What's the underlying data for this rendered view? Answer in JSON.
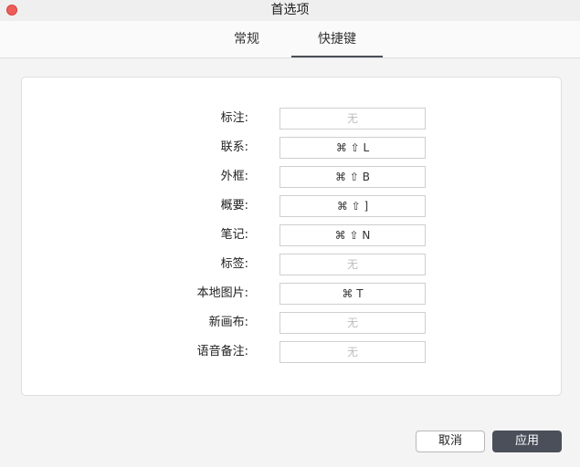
{
  "window": {
    "title": "首选项"
  },
  "tabs": [
    {
      "label": "常规",
      "active": false
    },
    {
      "label": "快捷键",
      "active": true
    }
  ],
  "shortcuts": [
    {
      "label": "标注:",
      "value": "无",
      "empty": true
    },
    {
      "label": "联系:",
      "value": "⌘ ⇧ L",
      "empty": false
    },
    {
      "label": "外框:",
      "value": "⌘ ⇧ B",
      "empty": false
    },
    {
      "label": "概要:",
      "value": "⌘ ⇧ ]",
      "empty": false
    },
    {
      "label": "笔记:",
      "value": "⌘ ⇧ N",
      "empty": false
    },
    {
      "label": "标签:",
      "value": "无",
      "empty": true
    },
    {
      "label": "本地图片:",
      "value": "⌘ T",
      "empty": false
    },
    {
      "label": "新画布:",
      "value": "无",
      "empty": true
    },
    {
      "label": "语音备注:",
      "value": "无",
      "empty": true
    }
  ],
  "buttons": {
    "cancel": "取消",
    "apply": "应用"
  },
  "colors": {
    "close": "#ee5d58",
    "accent": "#4a4f5a"
  },
  "icons": {
    "close": "close-icon"
  }
}
